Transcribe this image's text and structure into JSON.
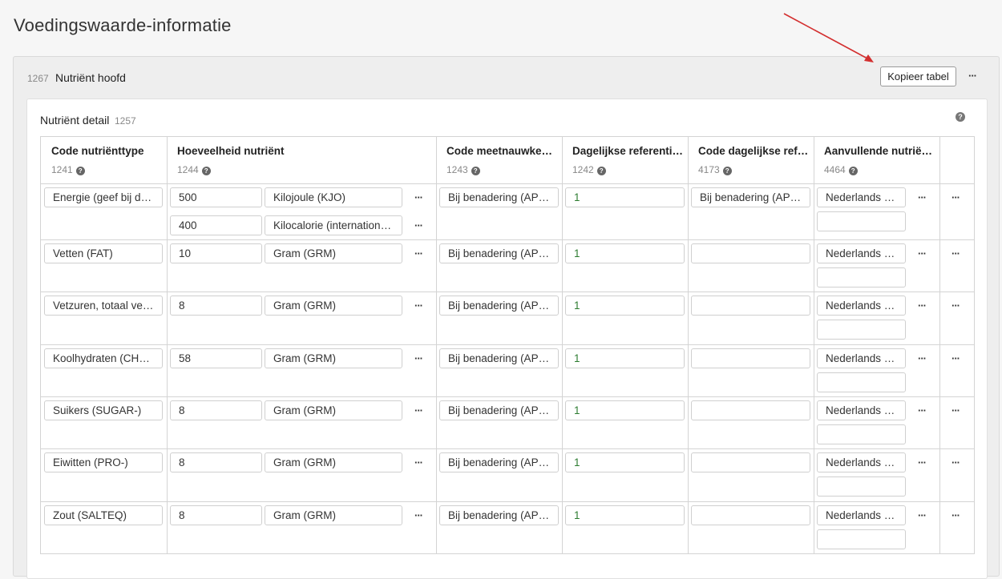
{
  "page": {
    "title": "Voedingswaarde-informatie"
  },
  "header_panel": {
    "id": "1267",
    "title": "Nutriënt hoofd",
    "copy_button": "Kopieer tabel",
    "menu": "···"
  },
  "detail": {
    "title": "Nutriënt detail",
    "id": "1257",
    "help": "?",
    "columns": [
      {
        "label": "Code nutriënttype",
        "id": "1241"
      },
      {
        "label": "Hoeveelheid nutriënt",
        "id": "1244"
      },
      {
        "label": "Code meetnauwke…",
        "id": "1243"
      },
      {
        "label": "Dagelijkse referenti…",
        "id": "1242"
      },
      {
        "label": "Code dagelijkse ref…",
        "id": "4173"
      },
      {
        "label": "Aanvullende nutrië…",
        "id": "4464"
      }
    ],
    "menu": "···",
    "rows": [
      {
        "type": "Energie (geef bij de…",
        "quantities": [
          {
            "value": "500",
            "unit": "Kilojoule (KJO)"
          },
          {
            "value": "400",
            "unit": "Kilocalorie (internationa…"
          }
        ],
        "precision": "Bij benadering (APP…",
        "daily_ref": "1",
        "daily_ref_code": "Bij benadering (APP…",
        "additional": "Nederlands (…",
        "additional_extra": ""
      },
      {
        "type": "Vetten (FAT)",
        "quantities": [
          {
            "value": "10",
            "unit": "Gram (GRM)"
          }
        ],
        "precision": "Bij benadering (APP…",
        "daily_ref": "1",
        "daily_ref_code": "",
        "additional": "Nederlands (…",
        "additional_extra": ""
      },
      {
        "type": "Vetzuren, totaal ver…",
        "quantities": [
          {
            "value": "8",
            "unit": "Gram (GRM)"
          }
        ],
        "precision": "Bij benadering (APP…",
        "daily_ref": "1",
        "daily_ref_code": "",
        "additional": "Nederlands (…",
        "additional_extra": ""
      },
      {
        "type": "Koolhydraten (CHO…",
        "quantities": [
          {
            "value": "58",
            "unit": "Gram (GRM)"
          }
        ],
        "precision": "Bij benadering (APP…",
        "daily_ref": "1",
        "daily_ref_code": "",
        "additional": "Nederlands (…",
        "additional_extra": ""
      },
      {
        "type": "Suikers (SUGAR-)",
        "quantities": [
          {
            "value": "8",
            "unit": "Gram (GRM)"
          }
        ],
        "precision": "Bij benadering (APP…",
        "daily_ref": "1",
        "daily_ref_code": "",
        "additional": "Nederlands (…",
        "additional_extra": ""
      },
      {
        "type": "Eiwitten (PRO-)",
        "quantities": [
          {
            "value": "8",
            "unit": "Gram (GRM)"
          }
        ],
        "precision": "Bij benadering (APP…",
        "daily_ref": "1",
        "daily_ref_code": "",
        "additional": "Nederlands (…",
        "additional_extra": ""
      },
      {
        "type": "Zout (SALTEQ)",
        "quantities": [
          {
            "value": "8",
            "unit": "Gram (GRM)"
          }
        ],
        "precision": "Bij benadering (APP…",
        "daily_ref": "1",
        "daily_ref_code": "",
        "additional": "Nederlands (…",
        "additional_extra": ""
      }
    ]
  },
  "colors": {
    "annotation_arrow": "#d32f2f",
    "daily_ref_value": "#2e7d32"
  }
}
